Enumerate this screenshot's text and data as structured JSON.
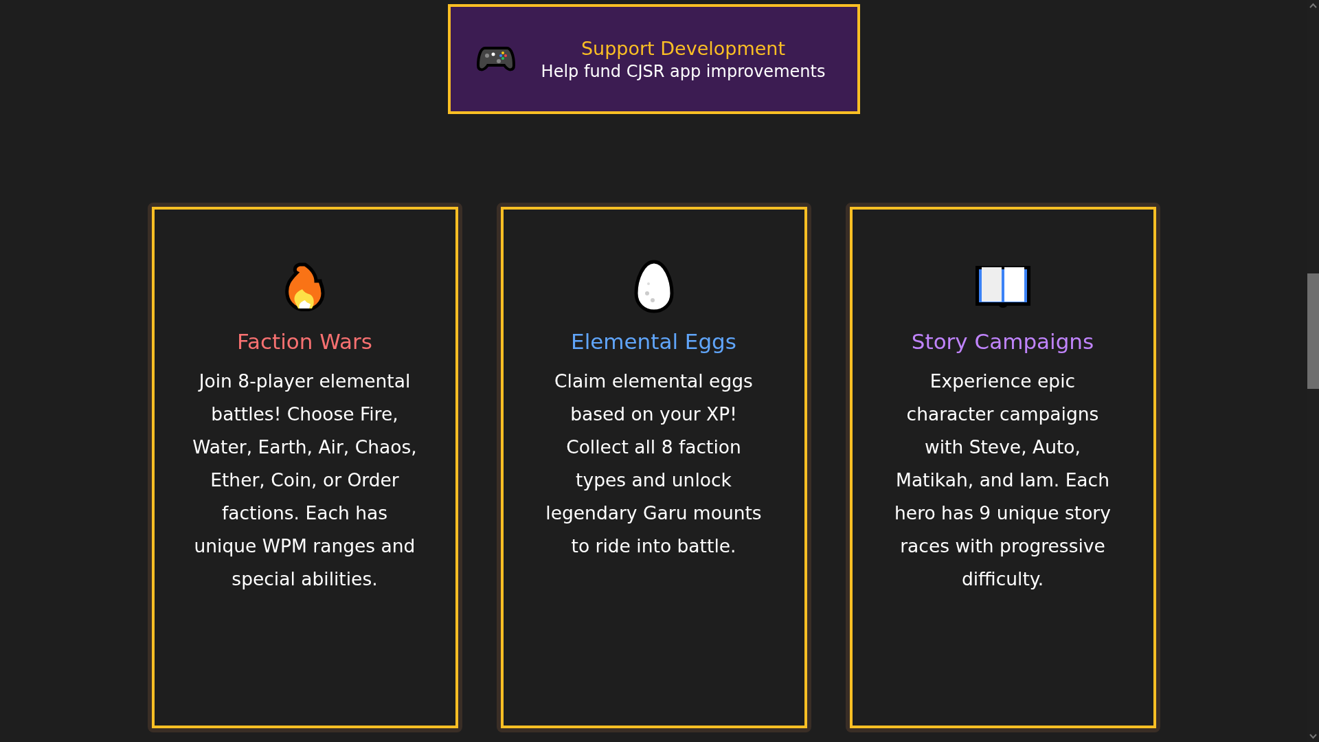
{
  "support_button": {
    "title": "Support Development",
    "subtitle": "Help fund CJSR app improvements"
  },
  "features": [
    {
      "kind": "fire",
      "title": "Faction Wars",
      "color": "#f87171",
      "description": "Join 8-player elemental battles! Choose Fire, Water, Earth, Air, Chaos, Ether, Coin, or Order factions. Each has unique WPM ranges and special abilities."
    },
    {
      "kind": "egg",
      "title": "Elemental Eggs",
      "color": "#60a5fa",
      "description": "Claim elemental eggs based on your XP! Collect all 8 faction types and unlock legendary Garu mounts to ride into battle."
    },
    {
      "kind": "book",
      "title": "Story Campaigns",
      "color": "#c084fc",
      "description": "Experience epic character campaigns with Steve, Auto, Matikah, and Iam. Each hero has 9 unique story races with progressive difficulty."
    }
  ]
}
